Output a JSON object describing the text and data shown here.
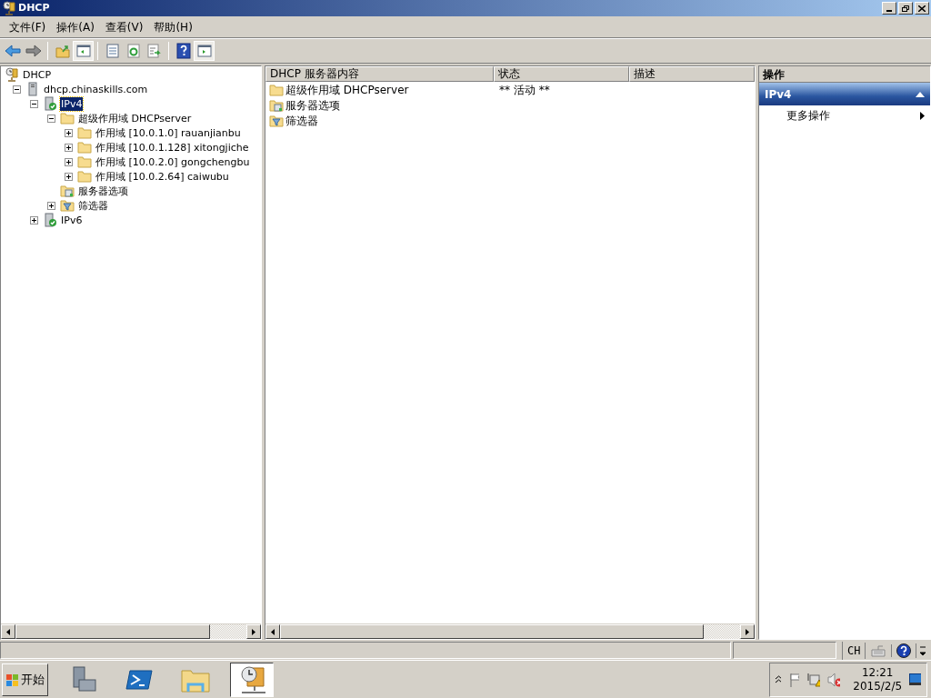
{
  "window": {
    "title": "DHCP"
  },
  "menu": [
    "文件(F)",
    "操作(A)",
    "查看(V)",
    "帮助(H)"
  ],
  "toolbar": [
    {
      "kind": "back"
    },
    {
      "kind": "forward"
    },
    {
      "kind": "sep"
    },
    {
      "kind": "up"
    },
    {
      "kind": "console-tree"
    },
    {
      "kind": "sep"
    },
    {
      "kind": "properties"
    },
    {
      "kind": "refresh"
    },
    {
      "kind": "export"
    },
    {
      "kind": "sep"
    },
    {
      "kind": "help"
    },
    {
      "kind": "action-pane"
    }
  ],
  "tree": [
    {
      "label": "DHCP",
      "kind": "dhcp",
      "selected": false,
      "children": [
        {
          "label": "dhcp.chinaskills.com",
          "kind": "server",
          "expanded": true,
          "selected": false,
          "children": [
            {
              "label": "IPv4",
              "kind": "server-ok",
              "expanded": true,
              "selected": true,
              "children": [
                {
                  "label": "超级作用域 DHCPserver",
                  "kind": "folder",
                  "expanded": true,
                  "selected": false,
                  "children": [
                    {
                      "label": "作用域 [10.0.1.0] rauanjianbu",
                      "kind": "folder",
                      "expanded": false,
                      "selected": false
                    },
                    {
                      "label": "作用域 [10.0.1.128] xitongjiche",
                      "kind": "folder",
                      "expanded": false,
                      "selected": false
                    },
                    {
                      "label": "作用域 [10.0.2.0] gongchengbu",
                      "kind": "folder",
                      "expanded": false,
                      "selected": false
                    },
                    {
                      "label": "作用域 [10.0.2.64] caiwubu",
                      "kind": "folder",
                      "expanded": false,
                      "selected": false
                    }
                  ]
                },
                {
                  "label": "服务器选项",
                  "kind": "options",
                  "selected": false
                },
                {
                  "label": "筛选器",
                  "kind": "filter",
                  "expanded": false,
                  "selected": false
                }
              ]
            },
            {
              "label": "IPv6",
              "kind": "server-ok",
              "expanded": false,
              "selected": false
            }
          ]
        }
      ]
    }
  ],
  "list": {
    "columns": [
      "DHCP 服务器内容",
      "状态",
      "描述"
    ],
    "rows": [
      {
        "kind": "folder",
        "name": "超级作用域 DHCPserver",
        "status": "** 活动 **"
      },
      {
        "kind": "options",
        "name": "服务器选项"
      },
      {
        "kind": "filter",
        "name": "筛选器"
      }
    ]
  },
  "actions": {
    "title": "操作",
    "section": "IPv4",
    "expanded": true,
    "items": [
      "更多操作"
    ]
  },
  "language_bar": {
    "language": "CH"
  },
  "taskbar": {
    "start": "开始",
    "apps": [
      {
        "kind": "server-manager",
        "selected": false
      },
      {
        "kind": "powershell",
        "selected": false
      },
      {
        "kind": "explorer",
        "selected": false
      },
      {
        "kind": "dhcp",
        "selected": true
      }
    ],
    "time": "12:21",
    "date": "2015/2/5"
  }
}
